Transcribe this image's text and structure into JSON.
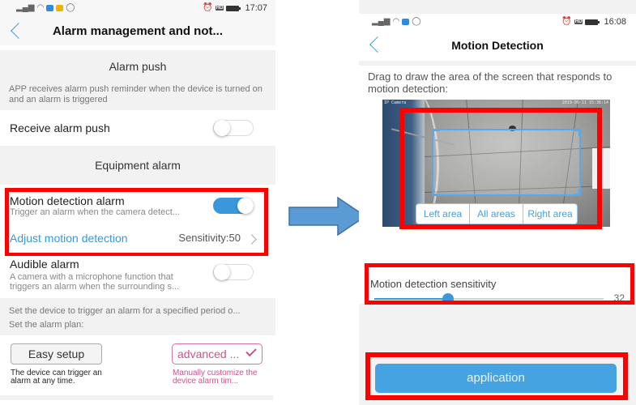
{
  "left_screen": {
    "status_bar": {
      "left_icons": [
        "signal-icon",
        "wifi-icon",
        "app-notification-icon",
        "messenger-icon",
        "whatsapp-icon"
      ],
      "right_icons": [
        "alarm-clock-icon",
        "hd-icon",
        "battery-icon"
      ],
      "time": "17:07"
    },
    "nav": {
      "title": "Alarm management and not..."
    },
    "alarm_push": {
      "section_title": "Alarm push",
      "note": "APP receives alarm push reminder when the device is turned on and an alarm is triggered",
      "receive": {
        "label": "Receive alarm push",
        "enabled": false
      }
    },
    "equipment_alarm": {
      "section_title": "Equipment alarm",
      "motion": {
        "title": "Motion detection alarm",
        "subtitle": "Trigger an alarm when the camera detect...",
        "enabled": true,
        "adjust_label": "Adjust motion detection",
        "sensitivity_text": "Sensitivity:50"
      },
      "audible": {
        "title": "Audible alarm",
        "subtitle": "A camera with a microphone function that triggers an alarm when the surrounding s...",
        "enabled": false
      }
    },
    "plan": {
      "note_line1": "Set the device to trigger an alarm for a specified period o...",
      "note_line2": "Set the alarm plan:",
      "easy_label": "Easy setup",
      "easy_desc": "The device can trigger an alarm at any time.",
      "advanced_label": "advanced ...",
      "advanced_desc": "Manually customize the device alarm tim..."
    }
  },
  "right_screen": {
    "status_bar": {
      "left_icons": [
        "signal-icon",
        "wifi-icon",
        "app-notification-icon",
        "whatsapp-icon"
      ],
      "right_icons": [
        "alarm-clock-icon",
        "hd-icon",
        "battery-icon"
      ],
      "time": "16:08"
    },
    "nav": {
      "title": "Motion Detection"
    },
    "instruction": "Drag to draw the area of the screen that responds to motion detection:",
    "camera": {
      "label_left": "IP Camera",
      "label_right": "2019-06-11 15:36:14"
    },
    "area_buttons": [
      "Left area",
      "All areas",
      "Right area"
    ],
    "sensitivity": {
      "label": "Motion detection sensitivity",
      "value": 32,
      "value_text": "32",
      "min": 0,
      "max": 100
    },
    "apply_label": "application"
  },
  "annotation": {
    "highlight_color": "#ff0000",
    "arrow_color": "#5b9bd5"
  },
  "colors": {
    "accent_blue": "#3a97dc",
    "advanced_pink": "#d0508c"
  }
}
